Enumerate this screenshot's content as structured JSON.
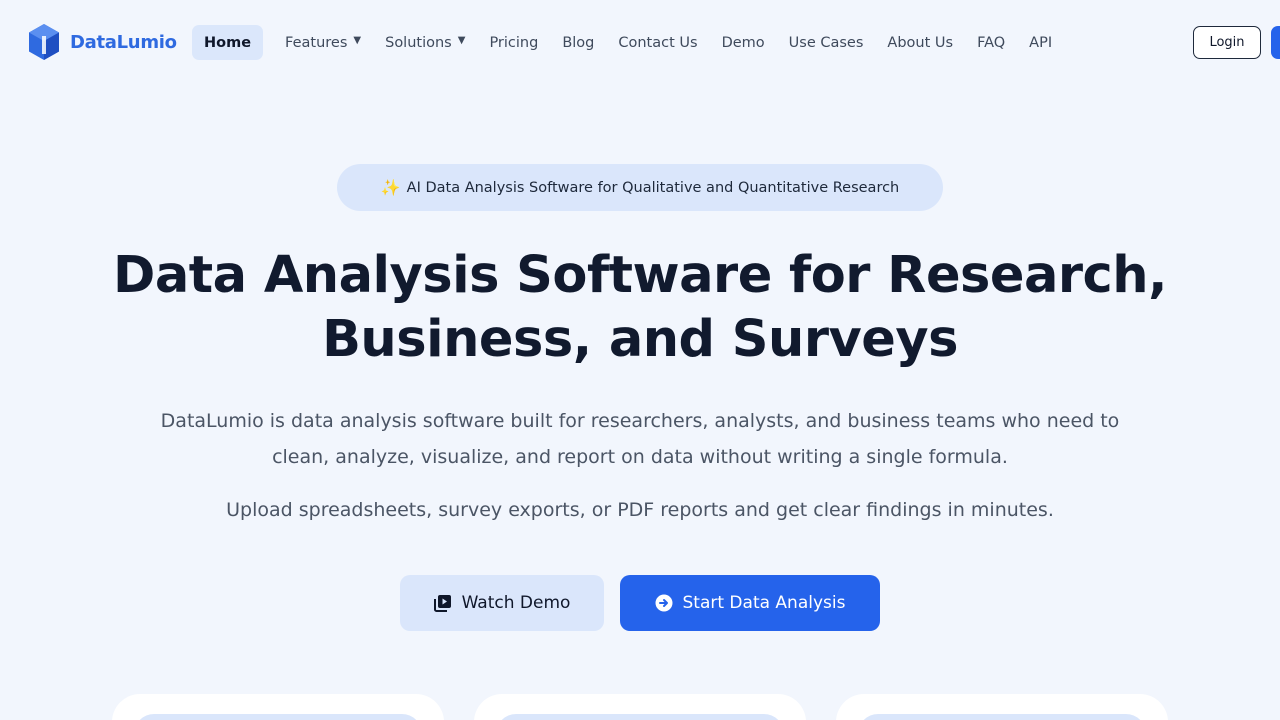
{
  "brand": {
    "name": "DataLumio",
    "accent": "#2563eb",
    "logo_color": "#2f6ae0"
  },
  "nav": {
    "items": [
      {
        "label": "Home",
        "active": true,
        "dropdown": false
      },
      {
        "label": "Features",
        "active": false,
        "dropdown": true
      },
      {
        "label": "Solutions",
        "active": false,
        "dropdown": true
      },
      {
        "label": "Pricing",
        "active": false,
        "dropdown": false
      },
      {
        "label": "Blog",
        "active": false,
        "dropdown": false
      },
      {
        "label": "Contact Us",
        "active": false,
        "dropdown": false
      },
      {
        "label": "Demo",
        "active": false,
        "dropdown": false
      },
      {
        "label": "Use Cases",
        "active": false,
        "dropdown": false
      },
      {
        "label": "About Us",
        "active": false,
        "dropdown": false
      },
      {
        "label": "FAQ",
        "active": false,
        "dropdown": false
      },
      {
        "label": "API",
        "active": false,
        "dropdown": false
      }
    ],
    "login_label": "Login",
    "caret": "▼"
  },
  "hero": {
    "badge_icon": "✨",
    "badge_text": "AI Data Analysis Software for Qualitative and Quantitative Research",
    "title_line1": "Data Analysis Software for Research,",
    "title_line2": "Business, and Surveys",
    "subtitle": "DataLumio is data analysis software built for researchers, analysts, and business teams who need to clean, analyze, visualize, and report on data without writing a single formula.",
    "subtitle2": "Upload spreadsheets, survey exports, or PDF reports and get clear findings in minutes.",
    "demo_button": {
      "label": "Watch Demo",
      "icon": "video-library-icon"
    },
    "start_button": {
      "label": "Start Data Analysis",
      "icon": "arrow-circle-right-icon"
    }
  }
}
